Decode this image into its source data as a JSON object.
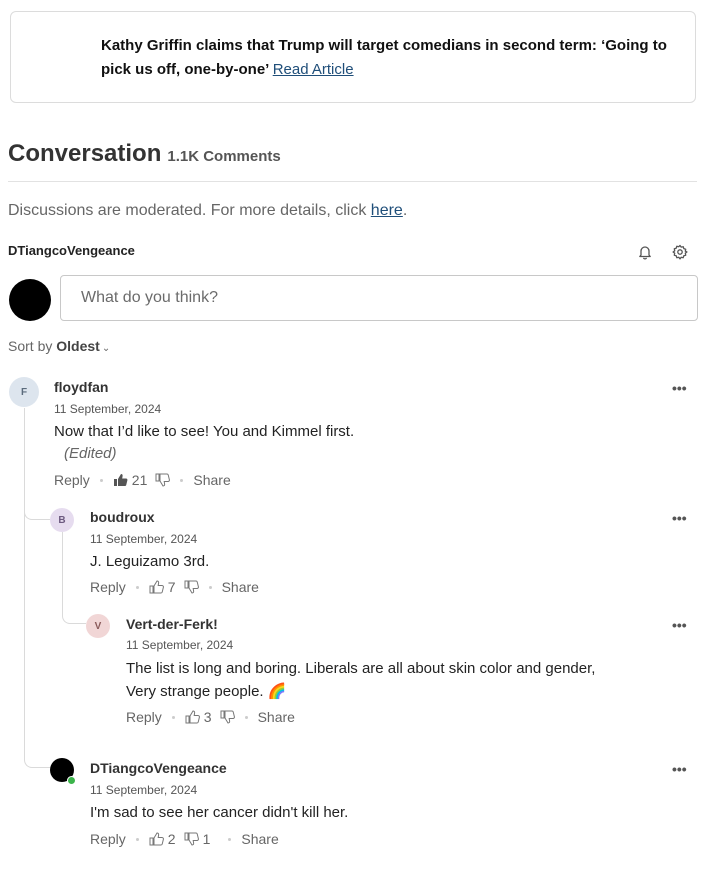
{
  "article": {
    "headline": "Kathy Griffin claims that Trump will target comedians in second term: ‘Going to pick us off, one-by-one’",
    "link": "Read Article"
  },
  "conversation": {
    "title": "Conversation",
    "count": "1.1K Comments",
    "moderated_text": "Discussions are moderated. For more details, click ",
    "moderated_link": "here",
    "moderated_end": ".",
    "current_user": "DTiangcoVengeance",
    "input_placeholder": "What do you think?",
    "sort_label": "Sort by",
    "sort_value": "Oldest"
  },
  "icons": {
    "bell": "bell-icon",
    "settings": "gear-icon",
    "more": "more-dots-icon",
    "like": "thumbs-up-icon",
    "dislike": "thumbs-down-icon",
    "sort": "chevron-down-icon"
  },
  "colors": {
    "link": "#1f4e79",
    "online": "#3cb44b"
  },
  "labels": {
    "reply": "Reply",
    "share": "Share",
    "more": "•••"
  },
  "comments": [
    {
      "initial": "F",
      "author": "floydfan",
      "date": "11 September, 2024",
      "lines": [
        "Now that I’d like to see!  You and Kimmel first."
      ],
      "edited": "(Edited)",
      "likes": "21",
      "dislikes": "",
      "liked": true
    },
    {
      "initial": "B",
      "author": "boudroux",
      "date": "11 September, 2024",
      "lines": [
        "J. Leguizamo 3rd."
      ],
      "likes": "7",
      "dislikes": ""
    },
    {
      "initial": "V",
      "author": "Vert-der-Ferk!",
      "date": "11 September, 2024",
      "lines": [
        "The list is long and boring. Liberals are all about skin color and gender,",
        "Very strange people. 🌈"
      ],
      "likes": "3",
      "dislikes": ""
    },
    {
      "initial": "",
      "author": "DTiangcoVengeance",
      "date": "11 September, 2024",
      "lines": [
        "I'm sad to see her cancer didn't kill her."
      ],
      "likes": "2",
      "dislikes": "1"
    }
  ]
}
